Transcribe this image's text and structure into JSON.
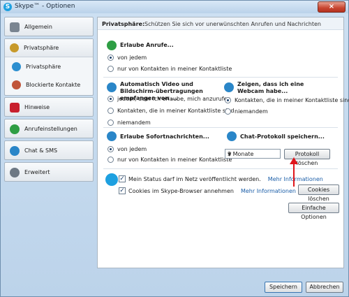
{
  "window": {
    "title": "Skype™ - Optionen",
    "close_glyph": "×"
  },
  "sidebar": {
    "items": [
      {
        "label": "Allgemein",
        "icon": "general-icon",
        "color": "#7a8591"
      },
      {
        "label": "Privatsphäre",
        "icon": "privacy-icon",
        "color": "#c79a2b"
      },
      {
        "label": "Privatsphäre",
        "icon": "privacy-sub-icon",
        "color": "#2c8fd0"
      },
      {
        "label": "Blockierte Kontakte",
        "icon": "blocked-contacts-icon",
        "color": "#c0553a"
      },
      {
        "label": "Hinweise",
        "icon": "flag-icon",
        "color": "#c8202e"
      },
      {
        "label": "Anrufeinstellungen",
        "icon": "phone-icon",
        "color": "#2e9e44"
      },
      {
        "label": "Chat & SMS",
        "icon": "chat-icon",
        "color": "#2a86c8"
      },
      {
        "label": "Erweitert",
        "icon": "advanced-icon",
        "color": "#6d7884"
      }
    ]
  },
  "panel": {
    "section_title": "Privatsphäre:",
    "section_desc": "Schützen Sie sich vor unerwünschten Anrufen und Nachrichten",
    "calls": {
      "title": "Erlaube Anrufe...",
      "options": [
        "von jedem",
        "nur von Kontakten in meiner Kontaktliste"
      ],
      "selected": 0
    },
    "video": {
      "title": "Automatisch Video und Bildschirm-übertragungen empfangen von ...",
      "options": [
        "jedem, dem ich erlaube, mich anzurufen",
        "Kontakten, die in meiner Kontaktliste sind",
        "niemandem"
      ],
      "selected": 0
    },
    "webcam": {
      "title": "Zeigen, dass ich eine Webcam habe...",
      "options": [
        "Kontakten, die in meiner Kontaktliste sind",
        "niemandem"
      ],
      "selected": 0
    },
    "im": {
      "title": "Erlaube Sofortnachrichten...",
      "options": [
        "von jedem",
        "nur von Kontakten in meiner Kontaktliste"
      ],
      "selected": 0
    },
    "chatlog": {
      "title": "Chat-Protokoll speichern...",
      "select_value": "3 Monate",
      "clear_button": "Protokoll löschen"
    },
    "online_status": {
      "label": "Mein Status darf im Netz veröffentlicht werden.",
      "checked": true,
      "link": "Mehr Informationen"
    },
    "cookies": {
      "label": "Cookies im Skype-Browser annehmen",
      "checked": true,
      "link": "Mehr Informationen",
      "button": "Cookies löschen"
    },
    "simple_options_button": "Einfache Optionen"
  },
  "footer": {
    "save": "Speichern",
    "cancel": "Abbrechen"
  },
  "colors": {
    "annotation_arrow": "#e0161c",
    "link": "#1b5ea8"
  }
}
